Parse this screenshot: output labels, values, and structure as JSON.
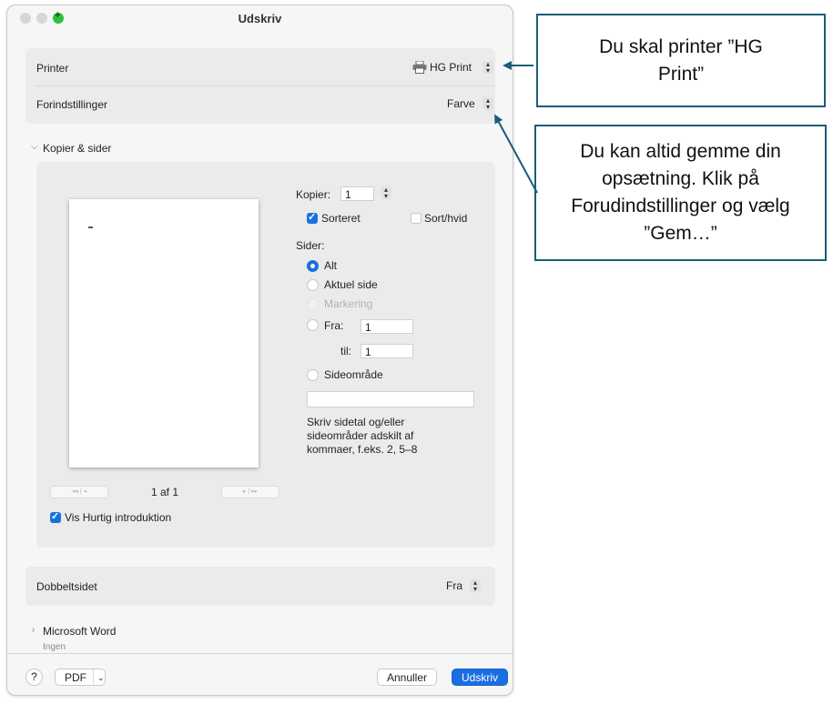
{
  "window": {
    "title": "Udskriv"
  },
  "printer": {
    "label": "Printer",
    "value": "HG Print",
    "icon": "printer-icon"
  },
  "presets": {
    "label": "Forindstillinger",
    "value": "Farve"
  },
  "copies_pages": {
    "section_title": "Kopier & sider",
    "copies_label": "Kopier:",
    "copies_value": "1",
    "collated_label": "Sorteret",
    "collated_checked": true,
    "bw_label": "Sort/hvid",
    "bw_checked": false,
    "pages_label": "Sider:",
    "options": {
      "all": "Alt",
      "current": "Aktuel side",
      "selection": "Markering",
      "from": "Fra:",
      "to": "til:",
      "range": "Sideområde"
    },
    "selected_option": "all",
    "from_value": "1",
    "to_value": "1",
    "range_value": "",
    "hint": "Skriv sidetal og/eller sideområder adskilt af kommaer, f.eks. 2, 5–8",
    "page_indicator": "1 af 1",
    "quick_intro_label": "Vis Hurtig introduktion",
    "quick_intro_checked": true
  },
  "duplex": {
    "label": "Dobbeltsidet",
    "value": "Fra"
  },
  "word": {
    "title": "Microsoft Word",
    "subtitle": "Ingen"
  },
  "footer": {
    "help": "?",
    "pdf": "PDF",
    "cancel": "Annuller",
    "print": "Udskriv"
  },
  "callouts": {
    "printer": "Du skal printer ”HG Print”",
    "presets": "Du kan altid gemme din opsætning. Klik på Forudindstillinger og vælg ”Gem…”"
  },
  "colors": {
    "accent": "#1a6fe0",
    "callout_border": "#1c5d7a"
  }
}
